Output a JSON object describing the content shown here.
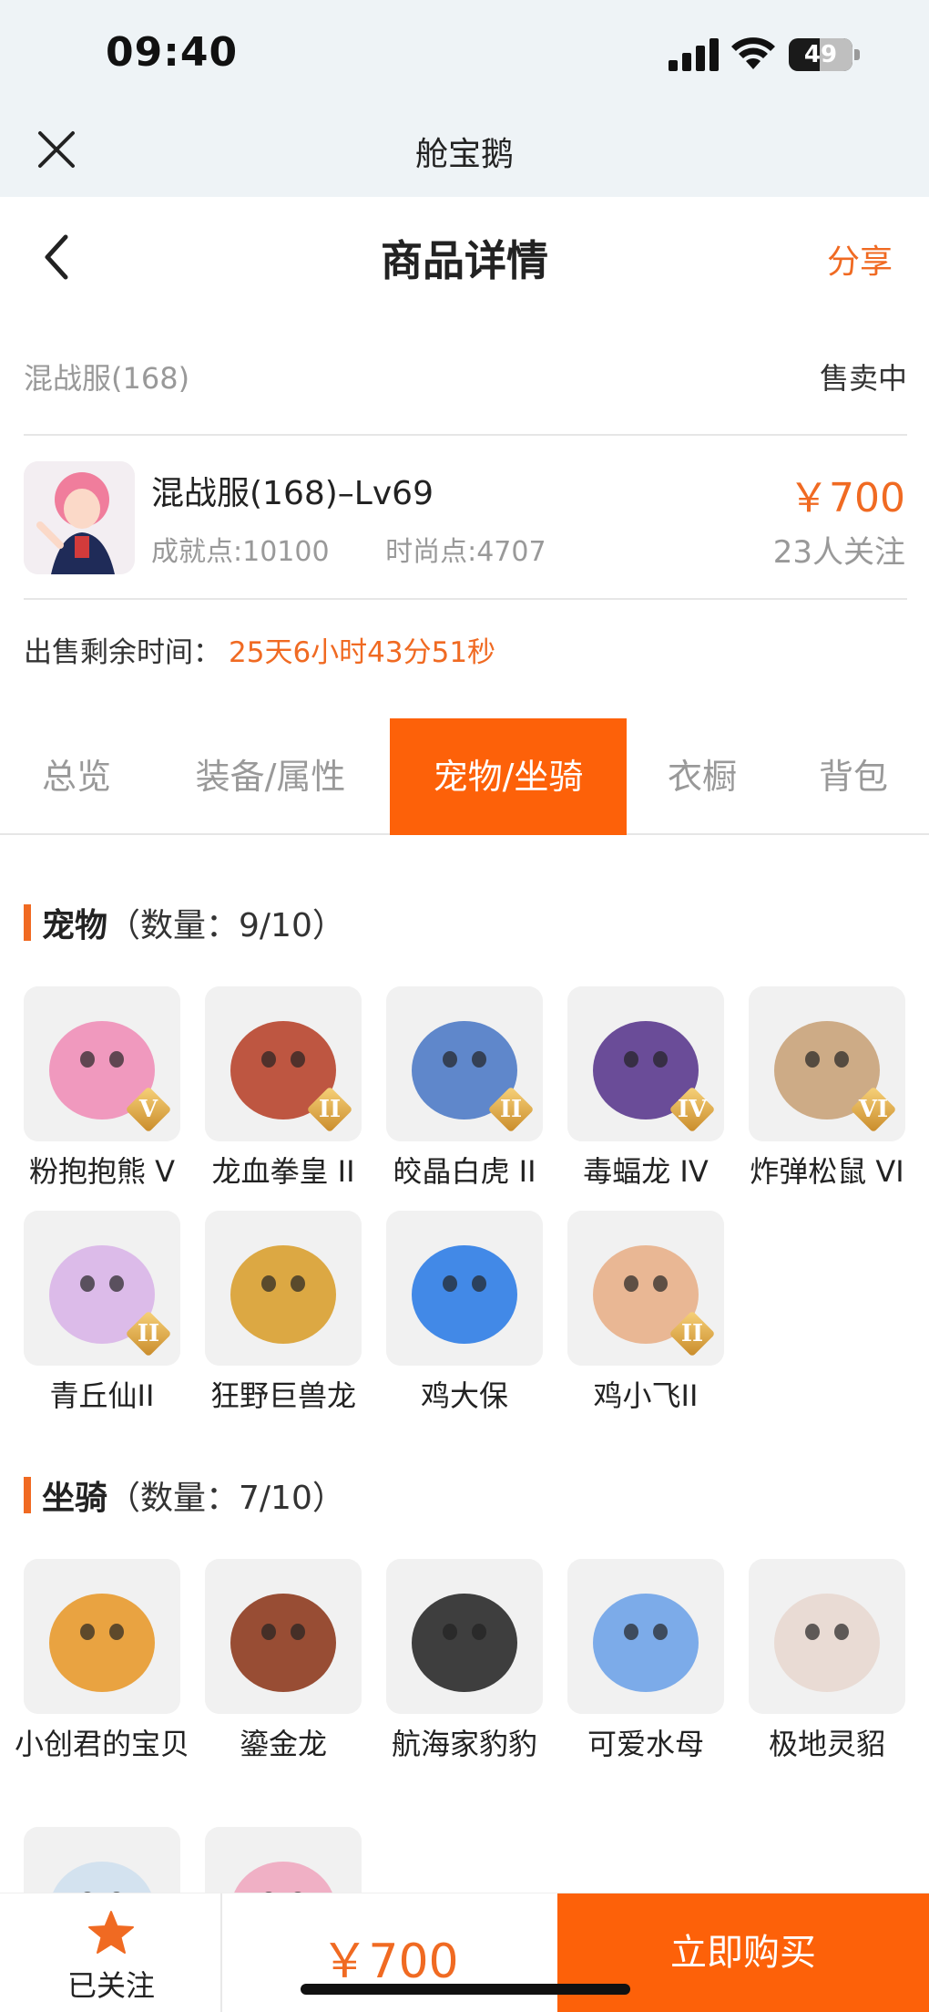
{
  "status_bar": {
    "time": "09:40",
    "battery": "49",
    "battery_level": 0.49
  },
  "web_header": {
    "title": "舱宝鹅"
  },
  "nav": {
    "title": "商品详情",
    "share": "分享"
  },
  "server": {
    "name": "混战服(168)",
    "status": "售卖中"
  },
  "item": {
    "title": "混战服(168)–Lv69",
    "achievement": "成就点:10100",
    "fashion": "时尚点:4707",
    "price": "￥700",
    "followers": "23人关注"
  },
  "remaining": {
    "label": "出售剩余时间：",
    "value": "25天6小时43分51秒"
  },
  "tabs": [
    {
      "label": "总览",
      "active": false
    },
    {
      "label": "装备/属性",
      "active": false
    },
    {
      "label": "宠物/坐骑",
      "active": true
    },
    {
      "label": "衣橱",
      "active": false
    },
    {
      "label": "背包",
      "active": false
    }
  ],
  "pets": {
    "title": "宠物",
    "count": "（数量：9/10）",
    "items": [
      {
        "name": "粉抱抱熊 V",
        "grade": "V",
        "color": "#f08fb8"
      },
      {
        "name": "龙血拳皇 II",
        "grade": "II",
        "color": "#b8452e"
      },
      {
        "name": "皎晶白虎 II",
        "grade": "II",
        "color": "#4f7bc7"
      },
      {
        "name": "毒蝠龙 IV",
        "grade": "IV",
        "color": "#5b3a8e"
      },
      {
        "name": "炸弹松鼠 VI",
        "grade": "VI",
        "color": "#c9a37a"
      },
      {
        "name": "青丘仙II",
        "grade": "II",
        "color": "#d9b5e8"
      },
      {
        "name": "狂野巨兽龙",
        "grade": "",
        "color": "#d9a030"
      },
      {
        "name": "鸡大保",
        "grade": "",
        "color": "#2f7de6"
      },
      {
        "name": "鸡小飞II",
        "grade": "II",
        "color": "#e8b08a"
      }
    ]
  },
  "mounts": {
    "title": "坐骑",
    "count": "（数量：7/10）",
    "items": [
      {
        "name": "小创君的宝贝",
        "color": "#e89a2e"
      },
      {
        "name": "鎏金龙",
        "color": "#8e3b1f"
      },
      {
        "name": "航海家豹豹",
        "color": "#2a2a2a"
      },
      {
        "name": "可爱水母",
        "color": "#6fa3e8"
      },
      {
        "name": "极地灵貂",
        "color": "#e8d8d0"
      },
      {
        "name": "",
        "color": "#cfe0ee"
      },
      {
        "name": "",
        "color": "#f0a8c0"
      }
    ]
  },
  "bottom": {
    "follow_label": "已关注",
    "price": "￥700",
    "buy_label": "立即购买"
  }
}
